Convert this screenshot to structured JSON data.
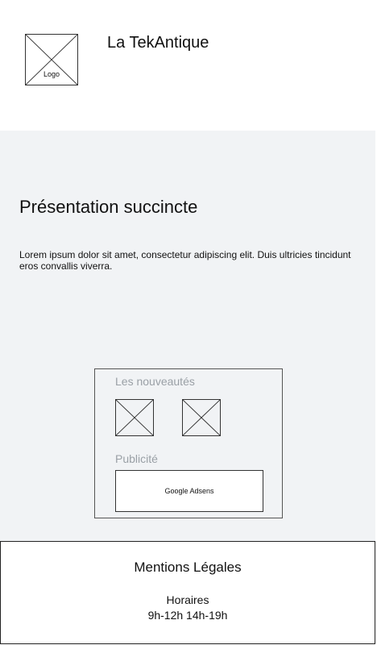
{
  "header": {
    "logo_label": "Logo",
    "site_title": "La TekAntique"
  },
  "presentation": {
    "title": "Présentation succincte",
    "text": "Lorem ipsum dolor sit amet, consectetur adipiscing elit. Duis ultricies tincidunt eros convallis viverra."
  },
  "news_panel": {
    "title": "Les nouveautés",
    "ad_title": "Publicité",
    "ad_label": "Google Adsens"
  },
  "footer": {
    "mentions": "Mentions Légales",
    "horaires_label": "Horaires",
    "horaires_value": "9h-12h 14h-19h"
  }
}
